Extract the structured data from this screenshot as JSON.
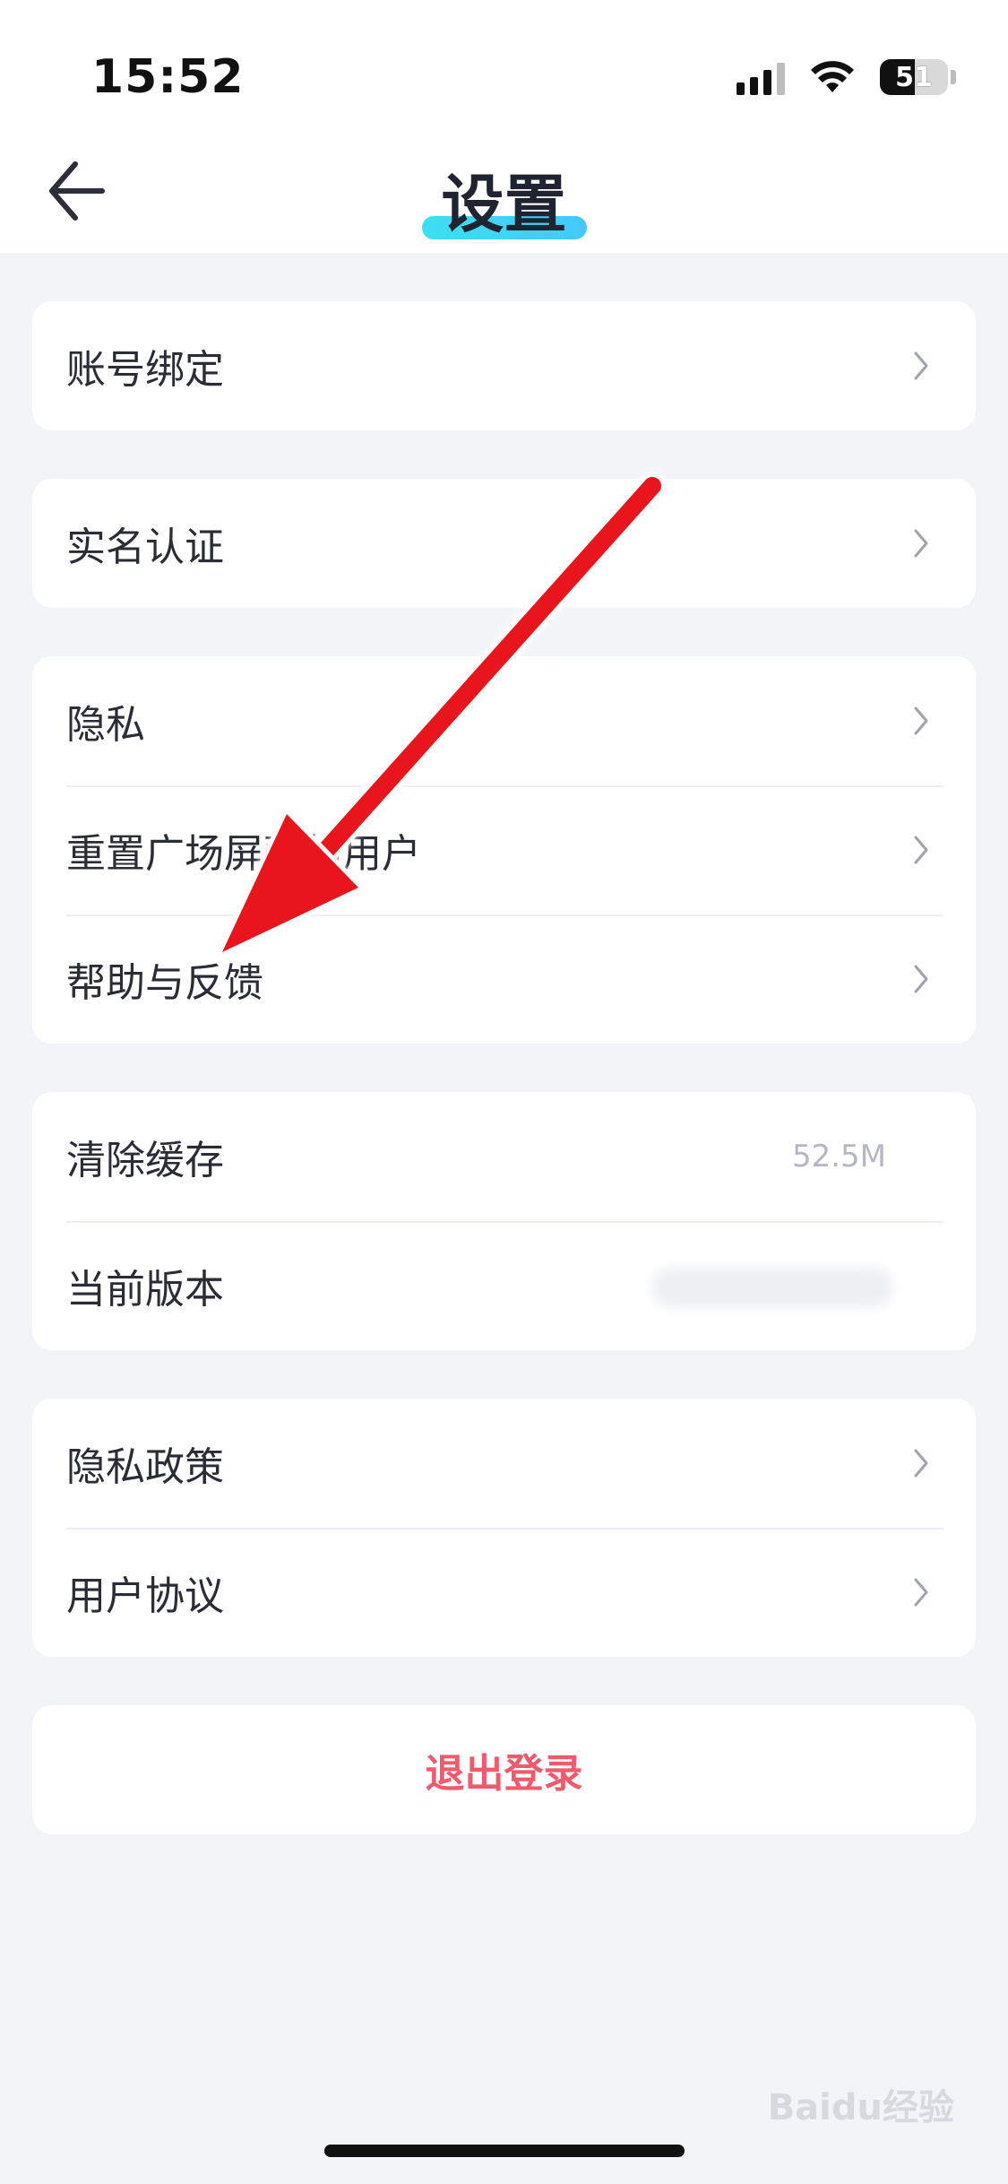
{
  "status_bar": {
    "time": "15:52",
    "battery": "51"
  },
  "header": {
    "title": "设置",
    "back_icon": "chevron-left-icon"
  },
  "groups": [
    {
      "items": [
        {
          "label": "账号绑定"
        }
      ]
    },
    {
      "items": [
        {
          "label": "实名认证"
        }
      ]
    },
    {
      "items": [
        {
          "label": "隐私"
        },
        {
          "label": "重置广场屏蔽的用户"
        },
        {
          "label": "帮助与反馈"
        }
      ]
    },
    {
      "items": [
        {
          "label": "清除缓存",
          "value": "52.5M"
        },
        {
          "label": "当前版本"
        }
      ]
    },
    {
      "items": [
        {
          "label": "隐私政策"
        },
        {
          "label": "用户协议"
        }
      ]
    }
  ],
  "logout": {
    "label": "退出登录"
  },
  "watermark": "Baidu经验",
  "colors": {
    "background": "#f3f4f8",
    "card": "#ffffff",
    "title_highlight": "#3ddff0",
    "logout": "#ef5b6d",
    "annotation_arrow": "#e8141b"
  }
}
